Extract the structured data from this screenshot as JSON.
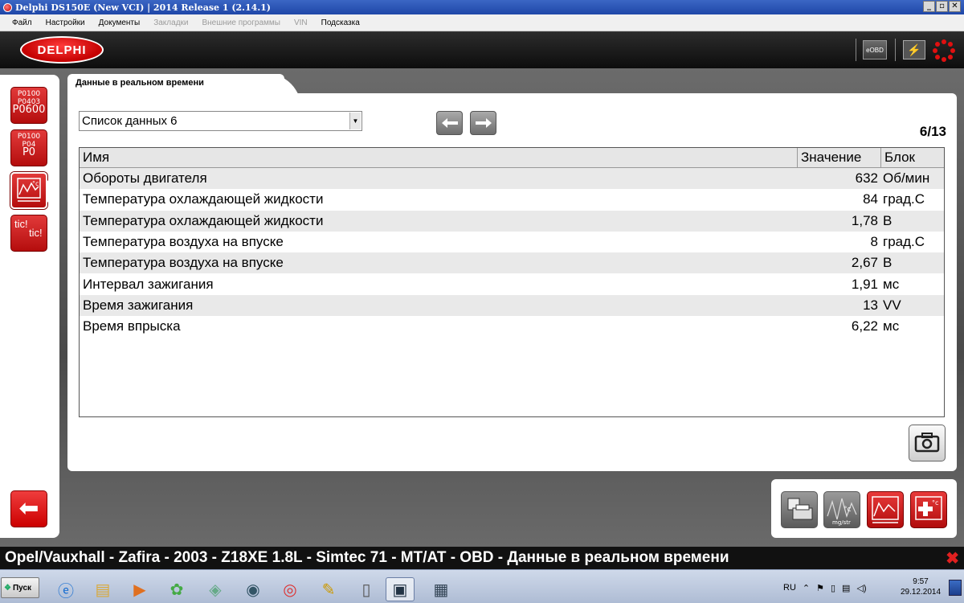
{
  "window": {
    "title": "Delphi DS150E (New VCI) | 2014 Release 1 (2.14.1)",
    "controls": {
      "minimize": "_",
      "maximize": "▫",
      "close": "✕"
    }
  },
  "menu": {
    "items": [
      {
        "label": "Файл",
        "enabled": true
      },
      {
        "label": "Настройки",
        "enabled": true
      },
      {
        "label": "Документы",
        "enabled": true
      },
      {
        "label": "Закладки",
        "enabled": false
      },
      {
        "label": "Внешние программы",
        "enabled": false
      },
      {
        "label": "VIN",
        "enabled": false
      },
      {
        "label": "Подсказка",
        "enabled": true
      }
    ]
  },
  "header": {
    "logo_text": "DELPHI",
    "eobd_label": "eOBD"
  },
  "sidebar": {
    "items": [
      {
        "name": "dtc-read",
        "codes": [
          "P0100",
          "P0403",
          "P0600"
        ]
      },
      {
        "name": "dtc-clear",
        "codes": [
          "P0100",
          "P04",
          "P0"
        ]
      },
      {
        "name": "live-data",
        "active": true
      },
      {
        "name": "activation",
        "codes": [
          "tic!",
          "tic!"
        ]
      }
    ]
  },
  "tab": {
    "label": "Данные в реальном времени"
  },
  "list_select": {
    "value": "Список данных 6"
  },
  "pager": {
    "text": "6/13"
  },
  "table": {
    "headers": {
      "name": "Имя",
      "value": "Значение",
      "unit": "Блок"
    },
    "rows": [
      {
        "name": "Обороты двигателя",
        "value": "632",
        "unit": "Об/мин"
      },
      {
        "name": "Температура охлаждающей жидкости",
        "value": "84",
        "unit": "град.С"
      },
      {
        "name": "Температура охлаждающей жидкости",
        "value": "1,78",
        "unit": "В"
      },
      {
        "name": "Температура воздуха на впуске",
        "value": "8",
        "unit": "град.С"
      },
      {
        "name": "Температура воздуха на впуске",
        "value": "2,67",
        "unit": "В"
      },
      {
        "name": "Интервал зажигания",
        "value": "1,91",
        "unit": "мс"
      },
      {
        "name": "Время зажигания",
        "value": "13",
        "unit": "VV"
      },
      {
        "name": "Время впрыска",
        "value": "6,22",
        "unit": "мс"
      }
    ]
  },
  "statusbar": {
    "text": "Opel/Vauxhall - Zafira - 2003 - Z18XE 1.8L - Simtec 71 - MT/AT - OBD - Данные в реальном времени"
  },
  "taskbar": {
    "start_label": "Пуск",
    "language": "RU",
    "time": "9:57",
    "date": "29.12.2014"
  },
  "colors": {
    "accent_red": "#c40000",
    "titlebar_blue": "#1f47a8"
  }
}
